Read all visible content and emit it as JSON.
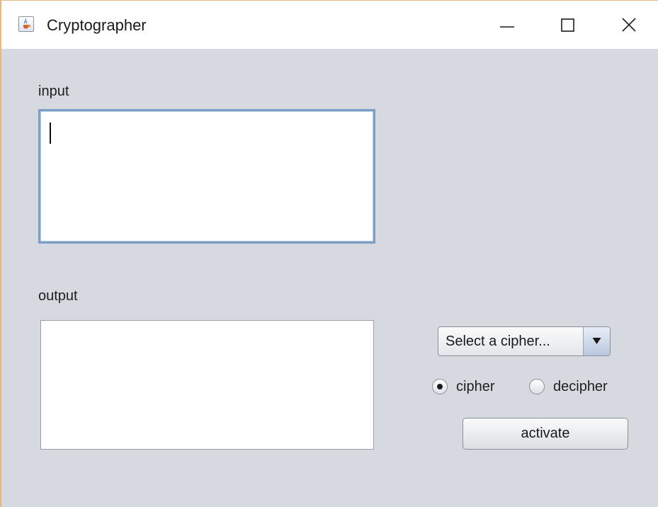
{
  "window": {
    "title": "Cryptographer",
    "app_icon": "java-coffee-icon",
    "controls": {
      "minimize_icon": "minimize-icon",
      "maximize_icon": "maximize-icon",
      "close_icon": "close-icon"
    }
  },
  "input": {
    "label": "input",
    "value": ""
  },
  "output": {
    "label": "output",
    "value": ""
  },
  "cipher_select": {
    "selected": "Select a cipher...",
    "arrow_icon": "triangle-down-icon"
  },
  "mode": {
    "options": [
      {
        "label": "cipher",
        "selected": true
      },
      {
        "label": "decipher",
        "selected": false
      }
    ]
  },
  "activate_button": {
    "label": "activate"
  },
  "colors": {
    "window_background": "#d6d9e0",
    "titlebar_background": "#ffffff",
    "focus_border": "#7b9ec6",
    "window_border": "#e2b98a"
  }
}
